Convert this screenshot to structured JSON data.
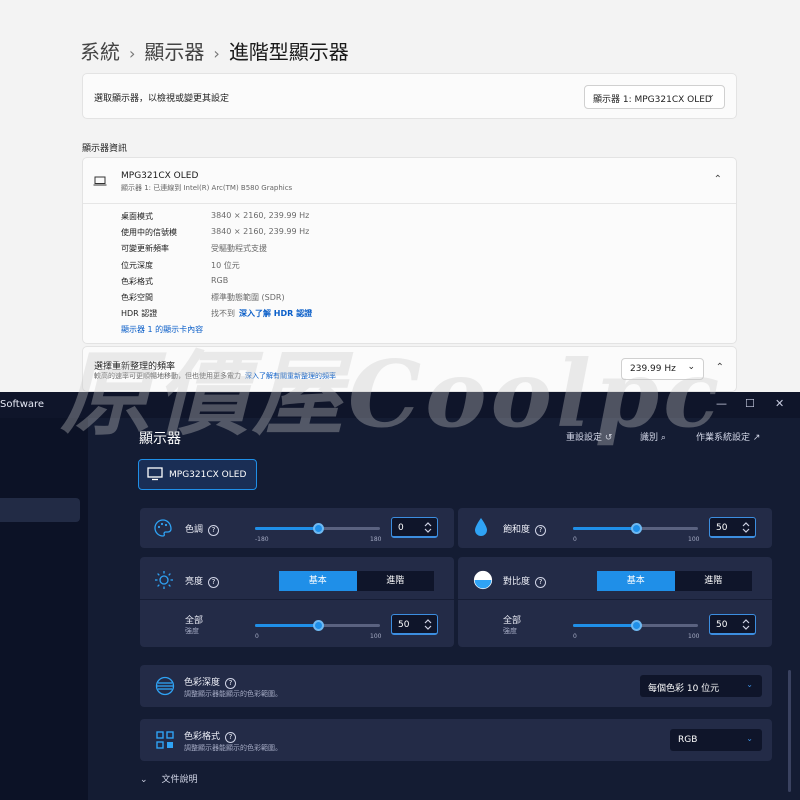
{
  "settings": {
    "breadcrumb": [
      "系統",
      "顯示器",
      "進階型顯示器"
    ],
    "select_label": "選取顯示器，以檢視或變更其設定",
    "select_value": "顯示器 1: MPG321CX OLED",
    "section_title": "顯示器資訊",
    "monitor_name": "MPG321CX OLED",
    "monitor_sub": "顯示器 1: 已連線到 Intel(R) Arc(TM) B580 Graphics",
    "info": [
      {
        "k": "桌面模式",
        "v": "3840 × 2160, 239.99 Hz"
      },
      {
        "k": "使用中的信號模",
        "v": "3840 × 2160, 239.99 Hz"
      },
      {
        "k": "可變更新頻率",
        "v": "受驅動程式支援"
      },
      {
        "k": "位元深度",
        "v": "10 位元"
      },
      {
        "k": "色彩格式",
        "v": "RGB"
      },
      {
        "k": "色彩空間",
        "v": "標準動態範圍 (SDR)"
      },
      {
        "k": "HDR 認證",
        "v": "找不到",
        "link": "深入了解 HDR 認證"
      }
    ],
    "adapter_link": "顯示器 1 的顯示卡內容",
    "refresh_title": "選擇重新整理的頻率",
    "refresh_desc": "較高的速率可更順暢地移動，但也使用更多電力",
    "refresh_link": "深入了解有關重新整理的頻率",
    "refresh_value": "239.99 Hz"
  },
  "app": {
    "title": "Software",
    "window_controls": [
      "—",
      "☐",
      "✕"
    ],
    "page_title": "顯示器",
    "actions": {
      "reset": "重設設定",
      "identify": "識別",
      "os_settings": "作業系統設定"
    },
    "monitor_button": "MPG321CX OLED",
    "hue": {
      "label": "色調",
      "value": "0",
      "min": "-180",
      "max": "180",
      "fraction": 0.5
    },
    "saturation": {
      "label": "飽和度",
      "value": "50",
      "min": "0",
      "max": "100",
      "fraction": 0.5
    },
    "brightness": {
      "label": "亮度",
      "tabs": [
        "基本",
        "進階"
      ],
      "sub": "全部",
      "sub2": "強度",
      "value": "50",
      "min": "0",
      "max": "100",
      "fraction": 0.5
    },
    "contrast": {
      "label": "對比度",
      "tabs": [
        "基本",
        "進階"
      ],
      "sub": "全部",
      "sub2": "強度",
      "value": "50",
      "min": "0",
      "max": "100",
      "fraction": 0.5
    },
    "color_depth": {
      "label": "色彩深度",
      "desc": "調整顯示器能顯示的色彩範圍。",
      "value": "每個色彩 10 位元"
    },
    "color_format": {
      "label": "色彩格式",
      "desc": "調整顯示器能顯示的色彩範圍。",
      "value": "RGB"
    },
    "docs": "文件說明"
  },
  "watermark": "原價屋Coolpc"
}
